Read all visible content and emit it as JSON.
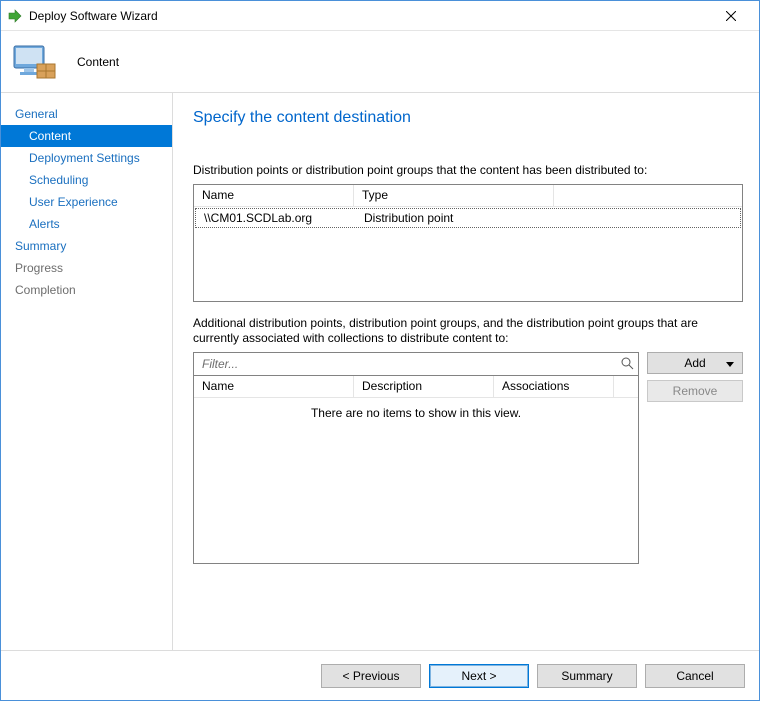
{
  "window": {
    "title": "Deploy Software Wizard"
  },
  "banner": {
    "title": "Content"
  },
  "sidebar": {
    "items": [
      {
        "label": "General",
        "kind": "top"
      },
      {
        "label": "Content",
        "kind": "sub",
        "selected": true
      },
      {
        "label": "Deployment Settings",
        "kind": "sub"
      },
      {
        "label": "Scheduling",
        "kind": "sub"
      },
      {
        "label": "User Experience",
        "kind": "sub"
      },
      {
        "label": "Alerts",
        "kind": "sub"
      },
      {
        "label": "Summary",
        "kind": "top"
      },
      {
        "label": "Progress",
        "kind": "disabled"
      },
      {
        "label": "Completion",
        "kind": "disabled"
      }
    ]
  },
  "content": {
    "heading": "Specify the content destination",
    "section1_label": "Distribution points or distribution point groups that the content has been distributed to:",
    "table1": {
      "headers": {
        "name": "Name",
        "type": "Type"
      },
      "rows": [
        {
          "name": "\\\\CM01.SCDLab.org",
          "type": "Distribution point"
        }
      ]
    },
    "section2_label": "Additional distribution points, distribution point groups, and the distribution point groups that are currently associated with collections to distribute content to:",
    "filter_placeholder": "Filter...",
    "table2": {
      "headers": {
        "name": "Name",
        "desc": "Description",
        "assoc": "Associations"
      },
      "empty_msg": "There are no items to show in this view."
    },
    "buttons": {
      "add": "Add",
      "remove": "Remove"
    }
  },
  "footer": {
    "previous": "< Previous",
    "next": "Next >",
    "summary": "Summary",
    "cancel": "Cancel"
  }
}
